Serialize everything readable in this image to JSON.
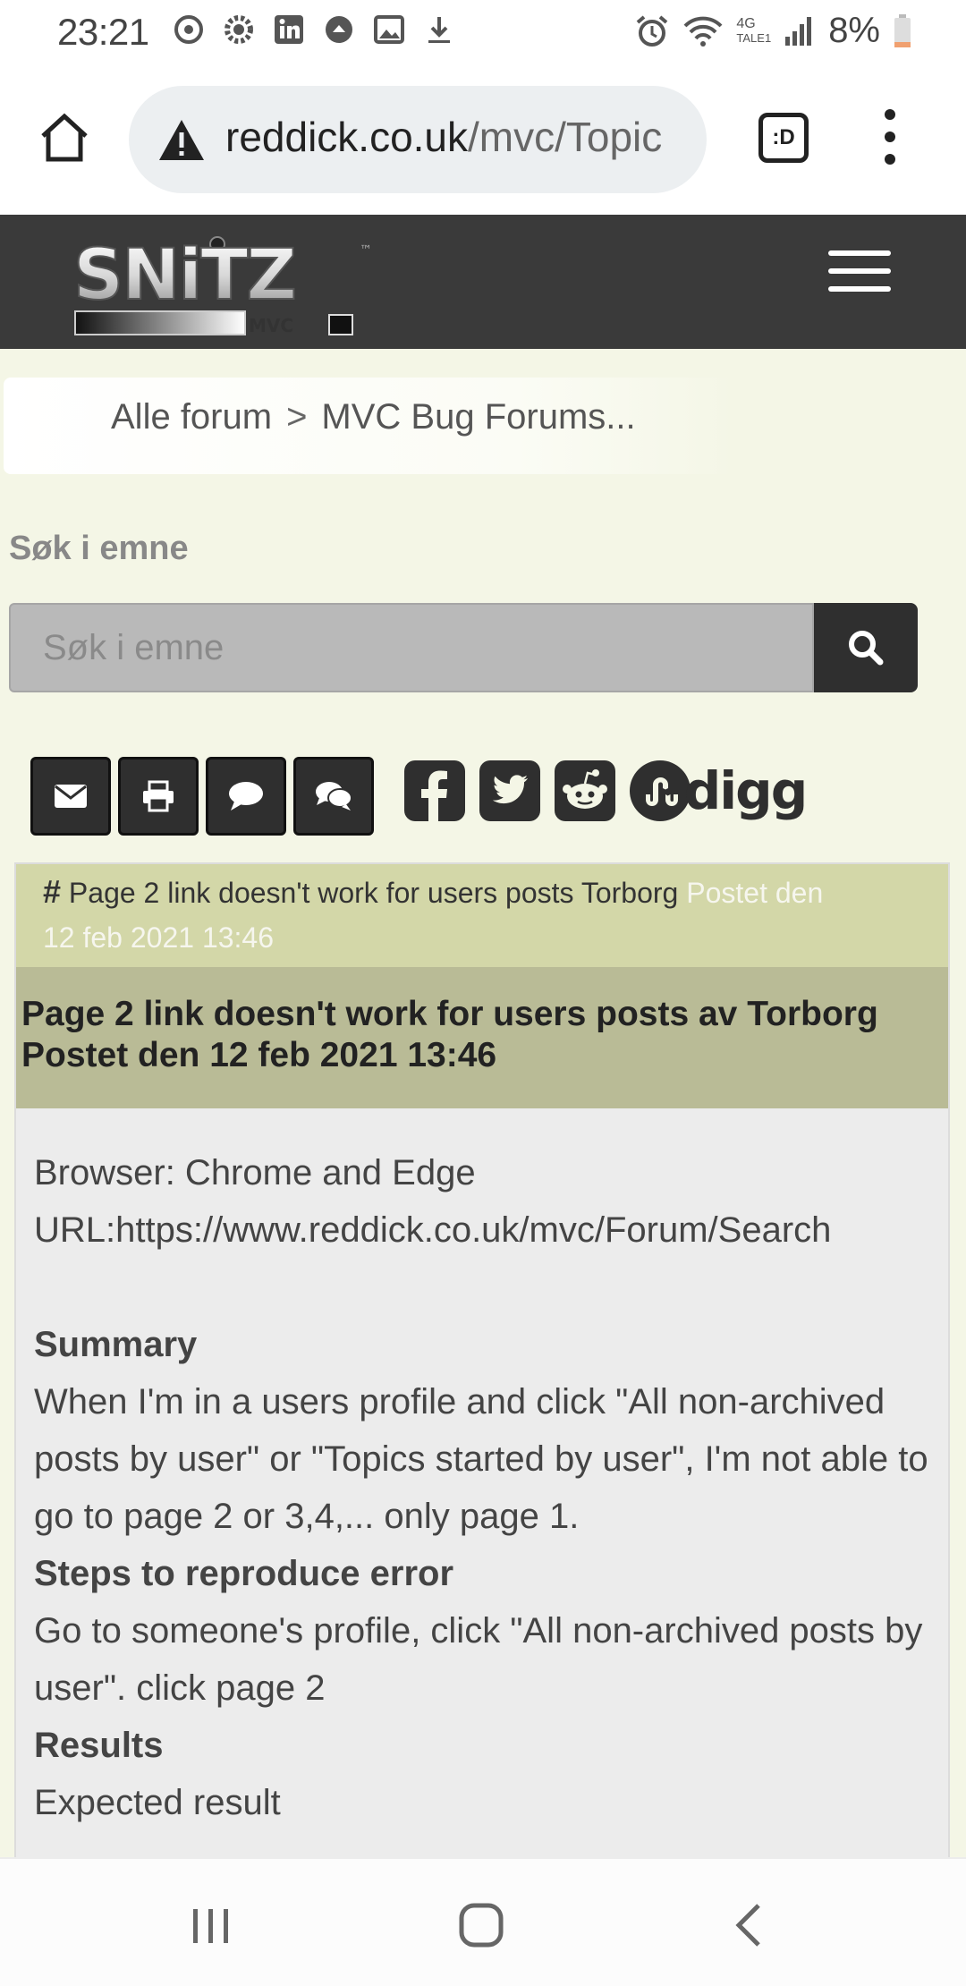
{
  "status_bar": {
    "time": "23:21",
    "battery": "8%",
    "network": "4G",
    "network_sub": "TALE1",
    "icons": [
      "sync-icon",
      "settings-icon",
      "linkedin-icon",
      "upload-icon",
      "image-icon",
      "download-icon",
      "alarm-icon",
      "wifi-icon",
      "signal-icon",
      "battery-icon"
    ]
  },
  "browser": {
    "url_domain": "reddick.co.uk",
    "url_path": "/mvc/Topic",
    "tabs_label": ":D"
  },
  "site": {
    "logo_text": "SNiTZ",
    "logo_sub": "MVC",
    "logo_tm": "™"
  },
  "breadcrumb": {
    "items": [
      "Alle forum",
      "MVC Bug Forums..."
    ],
    "separator": ">"
  },
  "search": {
    "label": "Søk i emne",
    "placeholder": "Søk i emne"
  },
  "social": {
    "digg_label": "digg"
  },
  "post": {
    "meta_hash": "#",
    "meta_title": "Page 2 link doesn't work for users posts Torborg",
    "meta_posted": "Postet den",
    "meta_date": "12 feb 2021 13:46",
    "heading_line1": "Page 2 link doesn't work for users posts av Torborg",
    "heading_line2": "Postet den 12 feb 2021 13:46",
    "browser_line": "Browser: Chrome and Edge",
    "url_line": "URL:https://www.reddick.co.uk/mvc/Forum/Search",
    "summary_heading": "Summary",
    "summary_text": "When I'm in a users profile and click \"All non-archived posts by user\" or \"Topics started by user\", I'm not able to go to page 2 or 3,4,... only page 1.",
    "steps_heading": "Steps to reproduce error",
    "steps_text": "Go to someone's profile, click \"All non-archived posts by user\". click page 2",
    "results_heading": "Results",
    "results_text": "Expected result",
    "divider_text": "--------------"
  },
  "colors": {
    "header_bg": "#3a3a3a",
    "page_bg": "#f4f6e6",
    "meta_bg": "#d3d7a8",
    "title_bg": "#b9bb96",
    "post_bg": "#ececec"
  }
}
